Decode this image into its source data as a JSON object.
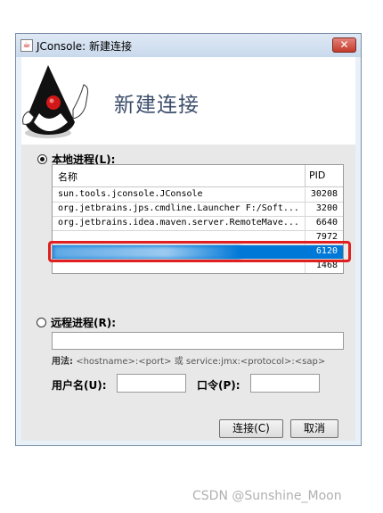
{
  "window": {
    "title": "JConsole: 新建连接",
    "close_symbol": "✕"
  },
  "banner": {
    "title": "新建连接"
  },
  "local": {
    "label": "本地进程(L):",
    "selected": true,
    "columns": [
      "名称",
      "PID"
    ],
    "rows": [
      {
        "name": "sun.tools.jconsole.JConsole",
        "pid": "30208"
      },
      {
        "name": "org.jetbrains.jps.cmdline.Launcher F:/Soft...",
        "pid": "3200"
      },
      {
        "name": "org.jetbrains.idea.maven.server.RemoteMave...",
        "pid": "6640"
      },
      {
        "name": "",
        "pid": "7972"
      },
      {
        "name": "",
        "pid": "6120"
      },
      {
        "name": "",
        "pid": "1468"
      }
    ]
  },
  "remote": {
    "label": "远程进程(R):",
    "selected": false,
    "address_value": "",
    "usage_label": "用法:",
    "usage_text": "<hostname>:<port> 或 service:jmx:<protocol>:<sap>",
    "username_label": "用户名(U):",
    "password_label": "口令(P):"
  },
  "buttons": {
    "connect": "连接(C)",
    "cancel": "取消"
  },
  "watermark": "CSDN @Sunshine_Moon"
}
